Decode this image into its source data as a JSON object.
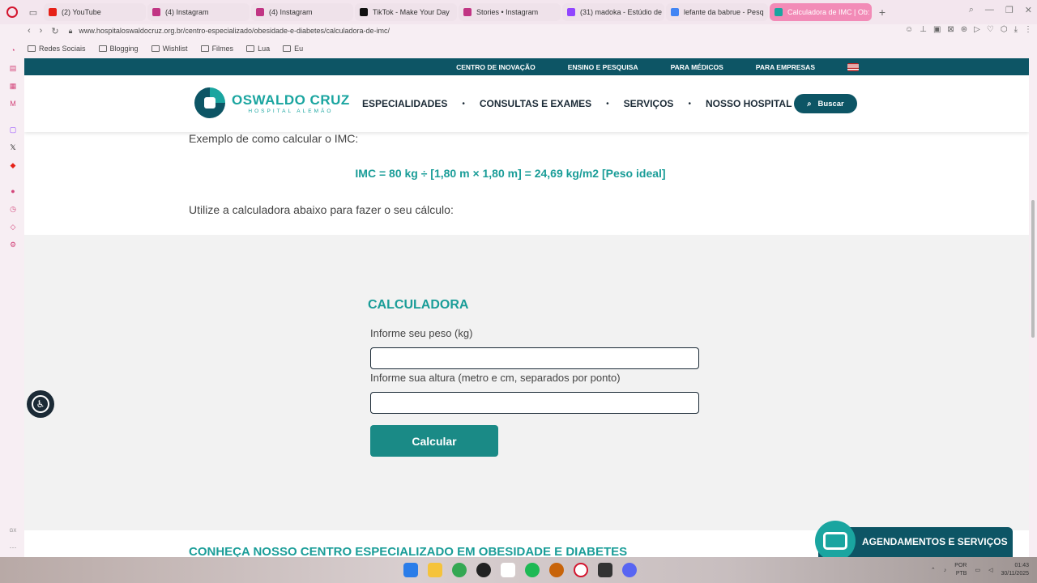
{
  "browser": {
    "tabs": [
      {
        "label": "(2) YouTube",
        "color": "#e62117"
      },
      {
        "label": "(4) Instagram",
        "color": "#c13584"
      },
      {
        "label": "(4) Instagram",
        "color": "#c13584"
      },
      {
        "label": "TikTok - Make Your Day",
        "color": "#111111"
      },
      {
        "label": "Stories • Instagram",
        "color": "#c13584"
      },
      {
        "label": "(31) madoka - Estúdio de",
        "color": "#9146ff"
      },
      {
        "label": "lefante da babrue - Pesq",
        "color": "#4285f4"
      },
      {
        "label": "Calculadora de IMC | Ob:",
        "color": "#1aa5a0"
      }
    ],
    "url": "www.hospitaloswaldocruz.org.br/centro-especializado/obesidade-e-diabetes/calculadora-de-imc/",
    "bookmarks": [
      "Redes Sociais",
      "Blogging",
      "Wishlist",
      "Filmes",
      "Lua",
      "Eu"
    ]
  },
  "site": {
    "topbar": [
      "CENTRO DE INOVAÇÃO",
      "ENSINO E PESQUISA",
      "PARA MÉDICOS",
      "PARA EMPRESAS"
    ],
    "logo": {
      "name": "OSWALDO CRUZ",
      "sub": "HOSPITAL ALEMÃO"
    },
    "menu": [
      "ESPECIALIDADES",
      "CONSULTAS E EXAMES",
      "SERVIÇOS",
      "NOSSO HOSPITAL"
    ],
    "search_label": "Buscar"
  },
  "content": {
    "example_text": "Exemplo de como calcular o IMC:",
    "formula": "IMC = 80 kg ÷ [1,80 m × 1,80 m] = 24,69 kg/m2 [Peso ideal]",
    "use_text": "Utilize a calculadora abaixo para fazer o seu cálculo:",
    "calculator": {
      "title": "CALCULADORA",
      "weight_label": "Informe seu peso (kg)",
      "height_label": "Informe sua altura (metro e cm, separados por ponto)",
      "weight_value": "",
      "height_value": "",
      "button": "Calcular"
    },
    "section2_title": "CONHEÇA NOSSO CENTRO ESPECIALIZADO EM OBESIDADE E DIABETES",
    "schedule_button": "AGENDAMENTOS E SERVIÇOS"
  },
  "taskbar": {
    "lang": "POR",
    "lang2": "PTB",
    "time": "01:43",
    "date": "30/11/2025"
  },
  "colors": {
    "brand_dark": "#0d5565",
    "brand_teal": "#1aa5a0"
  }
}
